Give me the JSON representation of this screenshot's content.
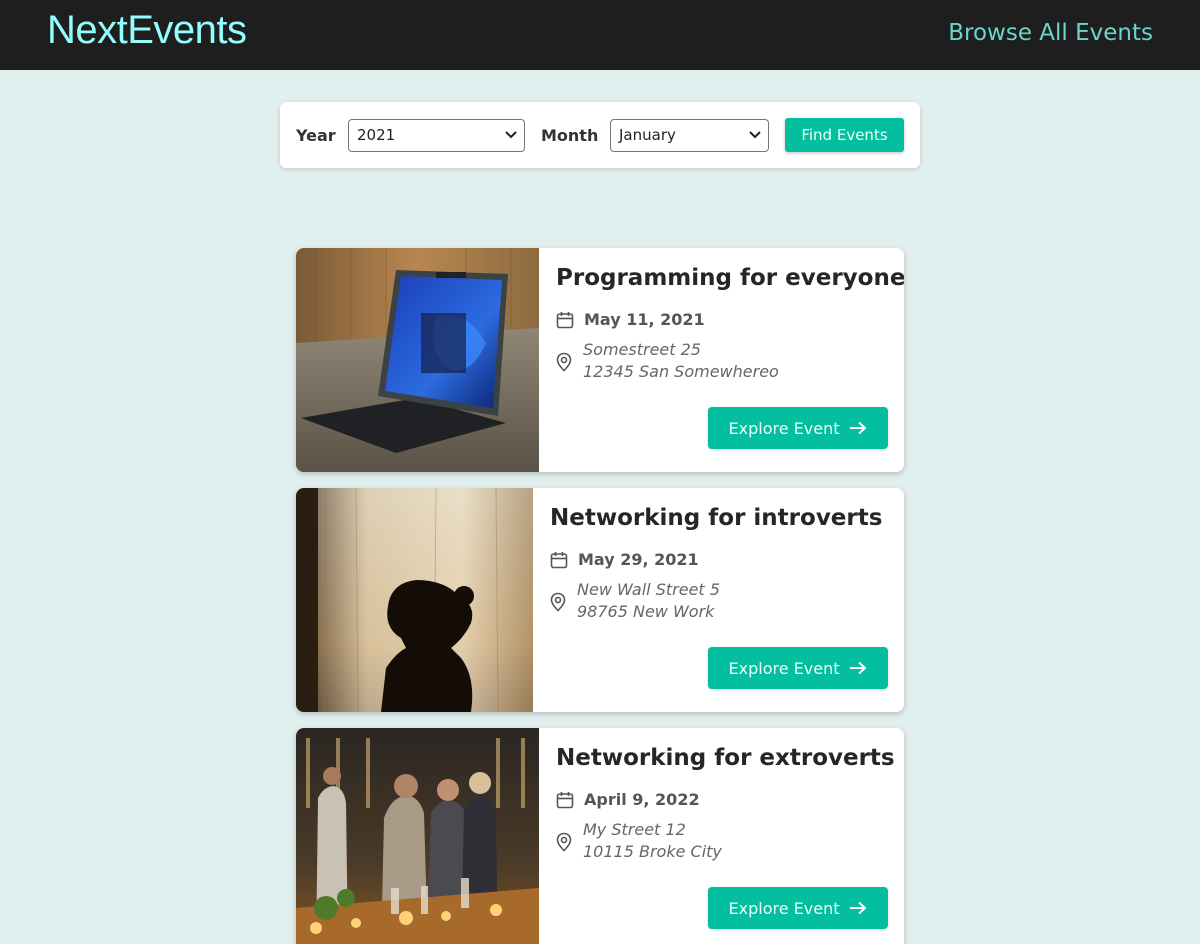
{
  "header": {
    "logo": "NextEvents",
    "nav_link": "Browse All Events"
  },
  "filter": {
    "year_label": "Year",
    "year_value": "2021",
    "month_label": "Month",
    "month_value": "January",
    "button_label": "Find Events"
  },
  "events": [
    {
      "title": "Programming for everyone",
      "date": "May 11, 2021",
      "address_line1": "Somestreet 25",
      "address_line2": "12345 San Somewhereo",
      "button_label": "Explore Event"
    },
    {
      "title": "Networking for introverts",
      "date": "May 29, 2021",
      "address_line1": "New Wall Street 5",
      "address_line2": "98765 New Work",
      "button_label": "Explore Event"
    },
    {
      "title": "Networking for extroverts",
      "date": "April 9, 2022",
      "address_line1": "My Street 12",
      "address_line2": "10115 Broke City",
      "button_label": "Explore Event"
    }
  ],
  "icons": {
    "date": "calendar-icon",
    "address": "location-pin-icon",
    "explore": "arrow-right-icon",
    "select": "chevron-down-icon"
  },
  "colors": {
    "accent": "#03be9f",
    "header_bg": "#1e1e1e",
    "logo": "#94fdfd",
    "page_bg": "#e1f0ef"
  }
}
